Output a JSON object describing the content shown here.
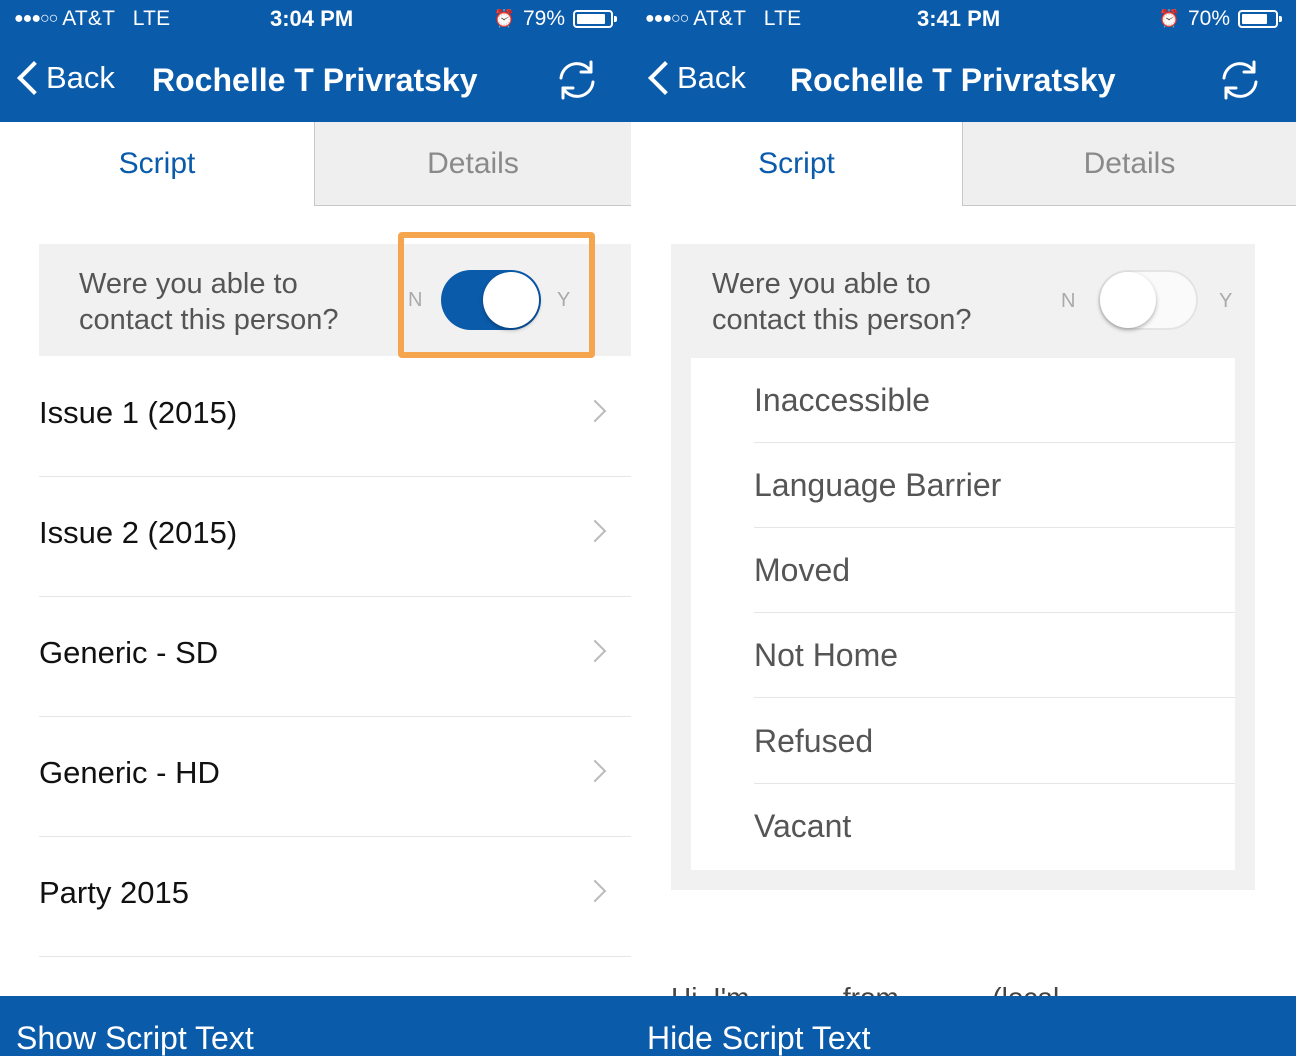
{
  "colors": {
    "primary": "#0b5bab",
    "highlight": "#f6a54f",
    "panel_bg": "#f1f1f1"
  },
  "left": {
    "status": {
      "signal": "●●●○○",
      "carrier": "AT&T",
      "network": "LTE",
      "time": "3:04 PM",
      "alarm_icon": "alarm-clock-icon",
      "battery": "79%",
      "battery_level": 0.79
    },
    "nav": {
      "back_label": "Back",
      "title": "Rochelle T Privratsky",
      "refresh_icon": "refresh-icon"
    },
    "tabs": [
      {
        "label": "Script",
        "active": true
      },
      {
        "label": "Details",
        "active": false
      }
    ],
    "contact": {
      "question": "Were you able to contact this person?",
      "question_line1": "Were you able to",
      "question_line2": "contact this person?",
      "no_label": "N",
      "yes_label": "Y",
      "toggle_on": true
    },
    "items": [
      {
        "label": "Issue 1 (2015)"
      },
      {
        "label": "Issue 2 (2015)"
      },
      {
        "label": "Generic - SD"
      },
      {
        "label": "Generic - HD"
      },
      {
        "label": "Party 2015"
      }
    ],
    "bottom": {
      "label": "Show Script Text"
    }
  },
  "right": {
    "status": {
      "signal": "●●●○○",
      "carrier": "AT&T",
      "network": "LTE",
      "time": "3:41 PM",
      "alarm_icon": "alarm-clock-icon",
      "battery": "70%",
      "battery_level": 0.7
    },
    "nav": {
      "back_label": "Back",
      "title": "Rochelle T Privratsky",
      "refresh_icon": "refresh-icon"
    },
    "tabs": [
      {
        "label": "Script",
        "active": true
      },
      {
        "label": "Details",
        "active": false
      }
    ],
    "contact": {
      "question": "Were you able to contact this person?",
      "question_line1": "Were you able to",
      "question_line2": "contact this person?",
      "no_label": "N",
      "yes_label": "Y",
      "toggle_on": false
    },
    "reasons": [
      {
        "label": "Inaccessible"
      },
      {
        "label": "Language Barrier"
      },
      {
        "label": "Moved"
      },
      {
        "label": "Not Home"
      },
      {
        "label": "Refused"
      },
      {
        "label": "Vacant"
      }
    ],
    "script_peek": "Hi, I'm _____ from _____ (local",
    "bottom": {
      "label": "Hide Script Text"
    }
  }
}
